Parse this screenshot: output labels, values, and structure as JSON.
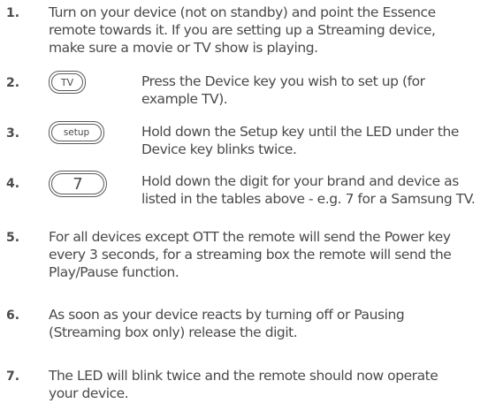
{
  "steps": [
    {
      "number": "1.",
      "text": "Turn on your device (not on standby) and point the Essence\nremote towards it. If you are setting up a Streaming device,\nmake sure a movie or TV show is playing."
    },
    {
      "number": "2.",
      "key_label": "TV",
      "key_icon": "tv-key-icon",
      "text": "Press the Device key you wish to set up (for\nexample TV)."
    },
    {
      "number": "3.",
      "key_label": "setup",
      "key_icon": "setup-key-icon",
      "text": "Hold down the Setup key until the LED under the\nDevice key blinks twice."
    },
    {
      "number": "4.",
      "key_label": "7",
      "key_icon": "digit-7-key-icon",
      "text": "Hold down the digit for your brand and device as\nlisted in the tables above - e.g. 7  for a Samsung TV."
    },
    {
      "number": "5.",
      "text": "For all devices except OTT the remote will send the Power key\nevery 3 seconds,  for a streaming box the remote will send the\nPlay/Pause function."
    },
    {
      "number": "6.",
      "text": "As soon as your device reacts by turning off or Pausing\n(Streaming box only) release the digit."
    },
    {
      "number": "7.",
      "text": "The LED will blink twice and the remote should now operate\nyour device."
    }
  ]
}
